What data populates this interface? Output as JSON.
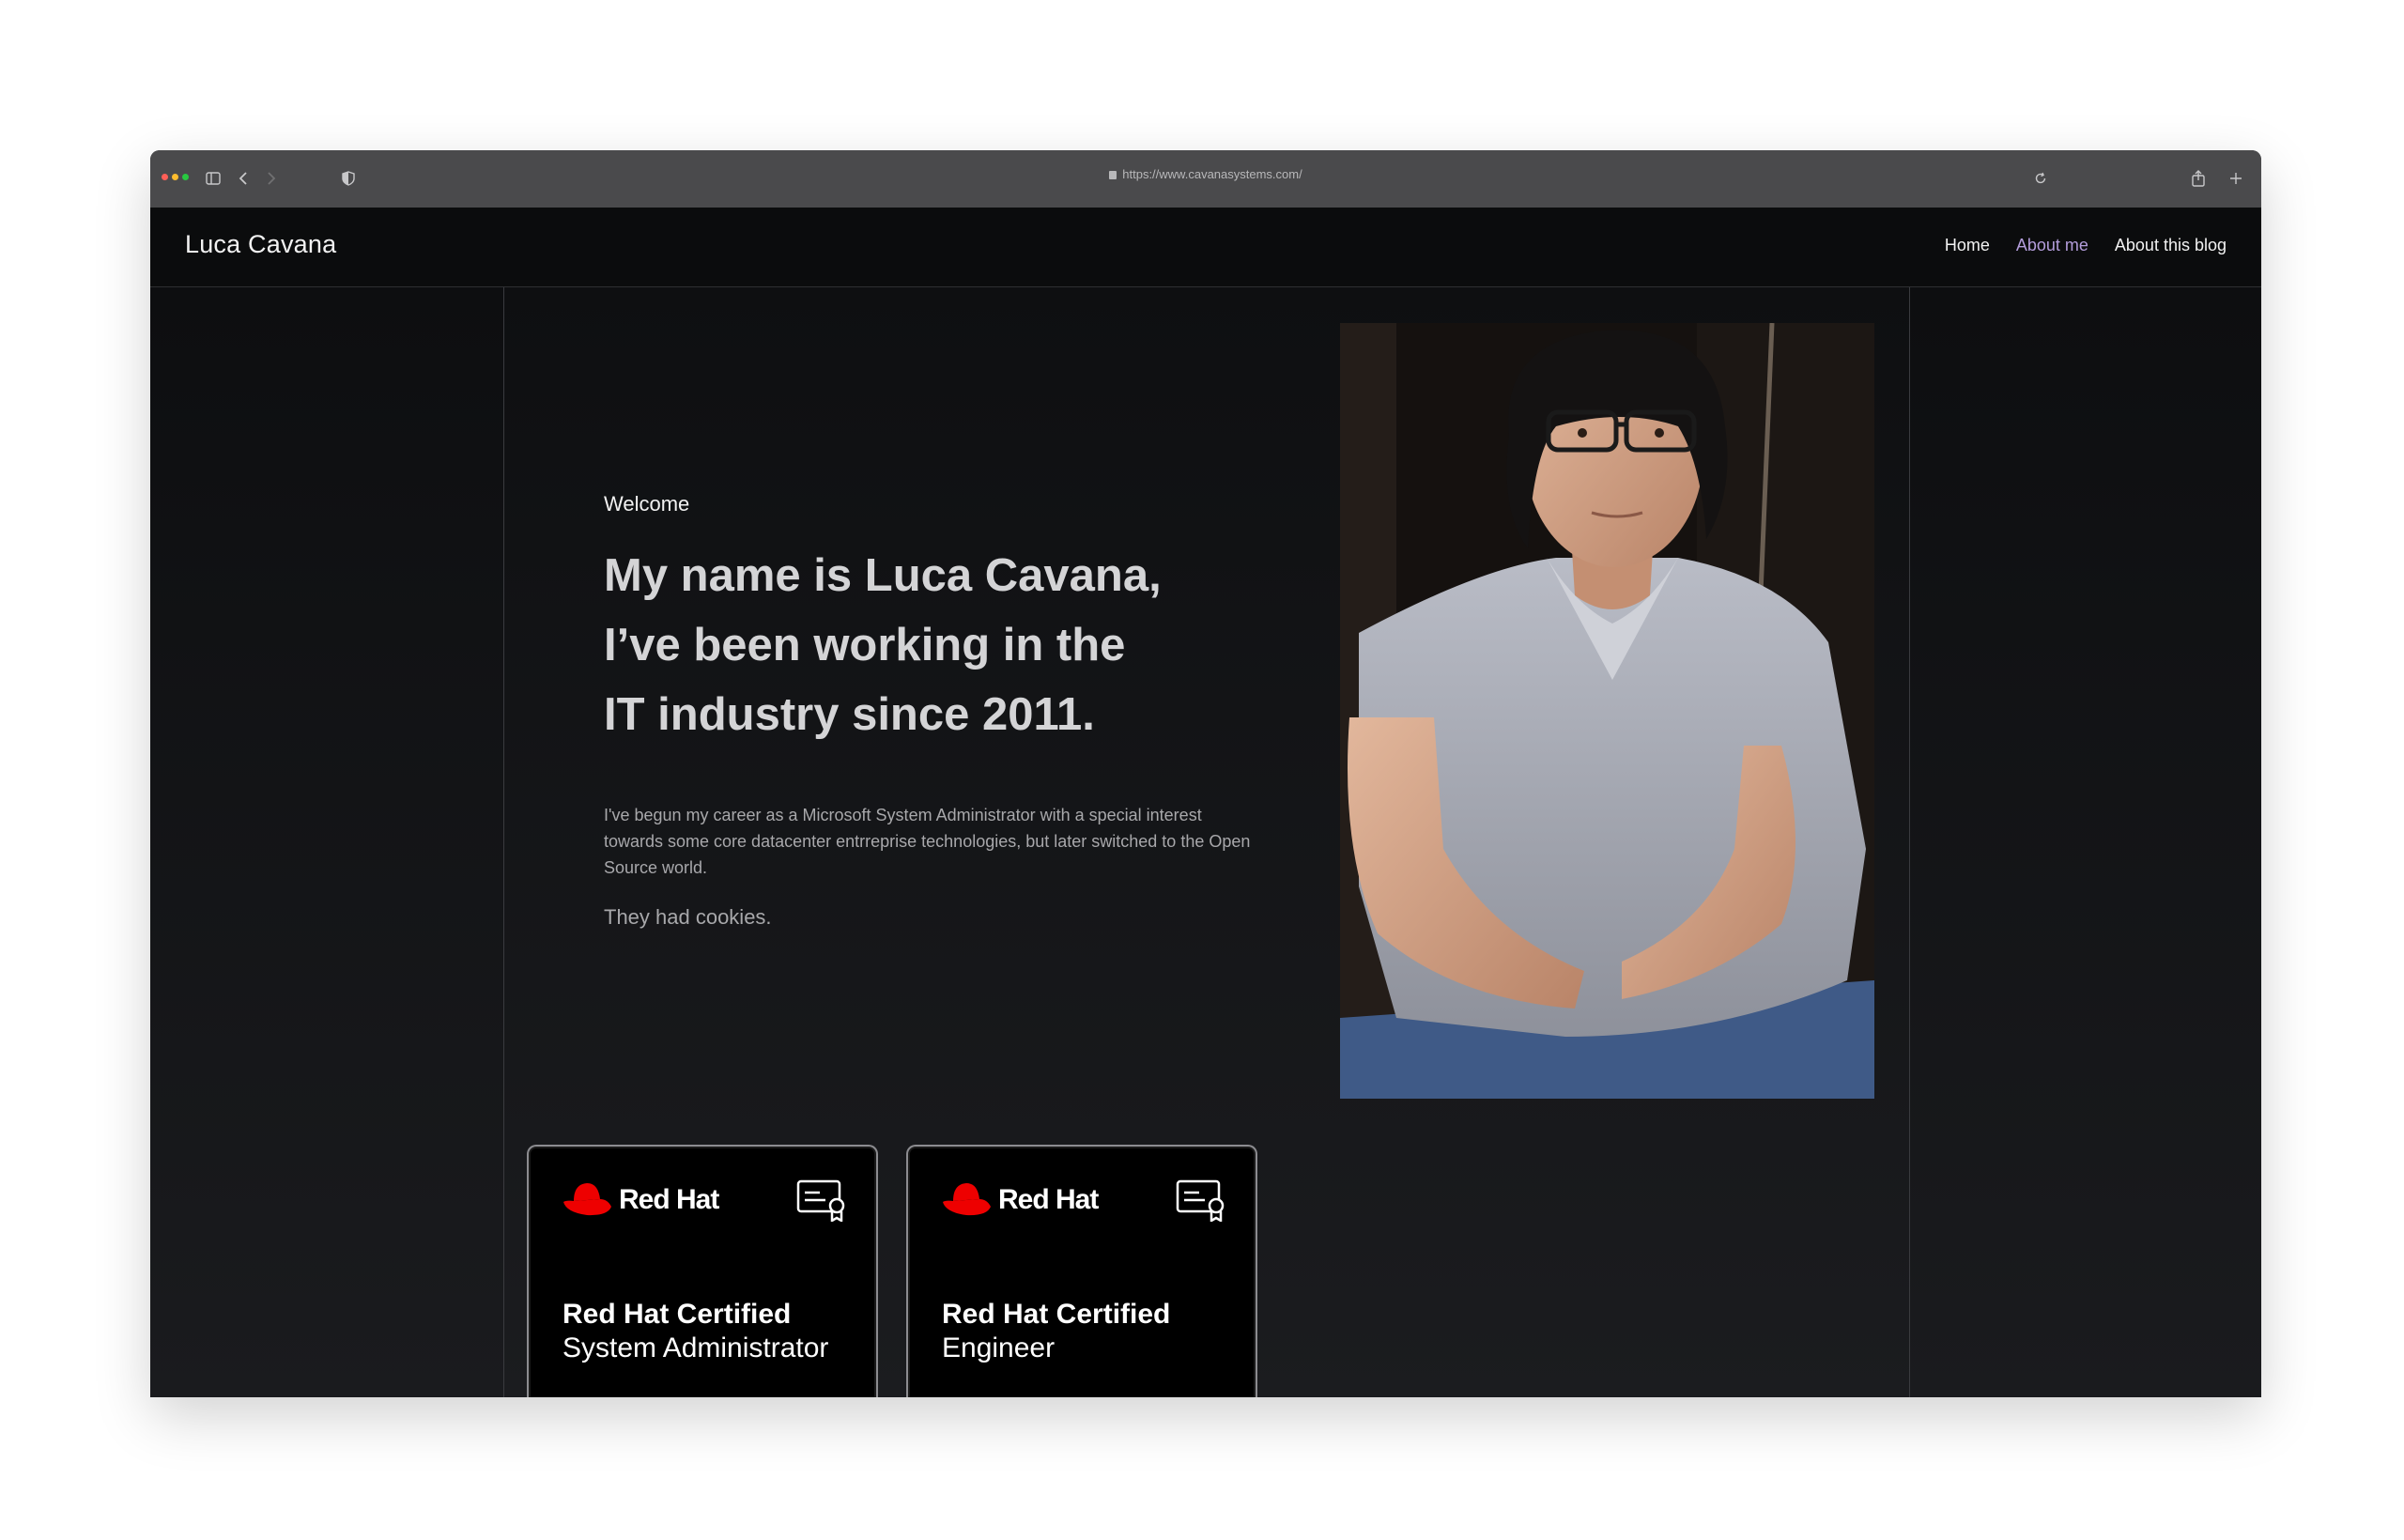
{
  "browser": {
    "url": "https://www.cavanasystems.com/"
  },
  "site": {
    "brand": "Luca Cavana",
    "nav": [
      {
        "label": "Home",
        "active": false
      },
      {
        "label": "About me",
        "active": true
      },
      {
        "label": "About this blog",
        "active": false
      }
    ]
  },
  "hero": {
    "welcome": "Welcome",
    "headline_lines": [
      "My name is Luca Cavana,",
      "I’ve been working in the",
      "IT industry since 2011."
    ],
    "bio": "I've begun my career as a Microsoft System Administrator with a special interest towards some core datacenter entrreprise technologies, but later switched to the Open Source world.",
    "cookies": "They had cookies."
  },
  "badges": [
    {
      "brand": "Red Hat",
      "title_bold": "Red Hat Certified",
      "title_regular": "System Administrator"
    },
    {
      "brand": "Red Hat",
      "title_bold": "Red Hat Certified",
      "title_regular": "Engineer"
    }
  ],
  "colors": {
    "accent_nav": "#b39ddb",
    "redhat_red": "#ee0000"
  }
}
